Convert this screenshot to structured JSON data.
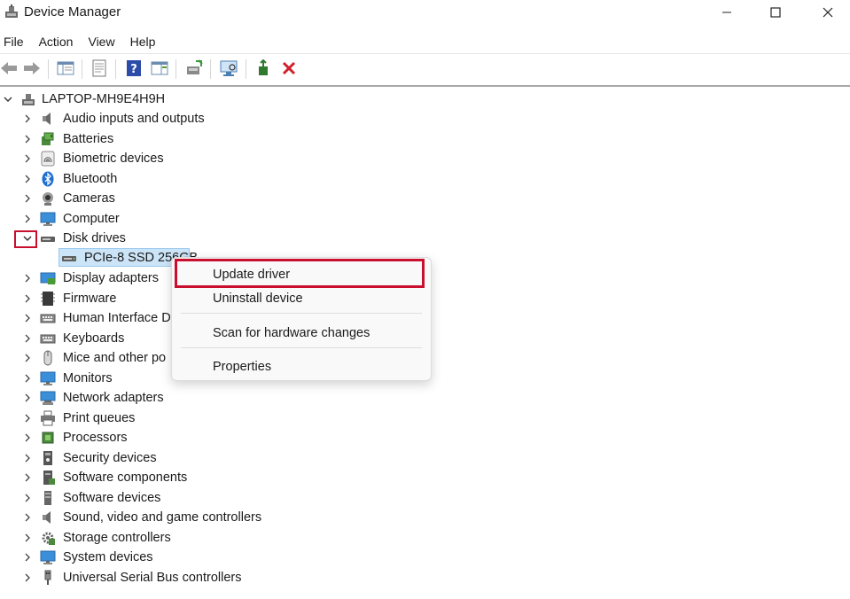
{
  "window": {
    "title": "Device Manager"
  },
  "menu": [
    "File",
    "Action",
    "View",
    "Help"
  ],
  "tree": {
    "root": "LAPTOP-MH9E4H9H",
    "categories": [
      {
        "label": "Audio inputs and outputs",
        "icon": "speaker-icon"
      },
      {
        "label": "Batteries",
        "icon": "battery-icon"
      },
      {
        "label": "Biometric devices",
        "icon": "fingerprint-icon"
      },
      {
        "label": "Bluetooth",
        "icon": "bluetooth-icon"
      },
      {
        "label": "Cameras",
        "icon": "camera-icon"
      },
      {
        "label": "Computer",
        "icon": "monitor-icon"
      },
      {
        "label": "Disk drives",
        "icon": "disk-drive-icon",
        "expanded": true
      },
      {
        "label": "Display adapters",
        "icon": "display-adapter-icon"
      },
      {
        "label": "Firmware",
        "icon": "firmware-icon"
      },
      {
        "label": "Human Interface D",
        "icon": "keyboard-icon"
      },
      {
        "label": "Keyboards",
        "icon": "keyboard-icon"
      },
      {
        "label": "Mice and other po",
        "icon": "mouse-icon"
      },
      {
        "label": "Monitors",
        "icon": "monitor-icon"
      },
      {
        "label": "Network adapters",
        "icon": "network-icon"
      },
      {
        "label": "Print queues",
        "icon": "printer-icon"
      },
      {
        "label": "Processors",
        "icon": "processor-icon"
      },
      {
        "label": "Security devices",
        "icon": "security-icon"
      },
      {
        "label": "Software components",
        "icon": "software-component-icon"
      },
      {
        "label": "Software devices",
        "icon": "software-device-icon"
      },
      {
        "label": "Sound, video and game controllers",
        "icon": "speaker-icon"
      },
      {
        "label": "Storage controllers",
        "icon": "storage-controller-icon"
      },
      {
        "label": "System devices",
        "icon": "system-device-icon"
      },
      {
        "label": "Universal Serial Bus controllers",
        "icon": "usb-icon"
      }
    ],
    "disk_child": "PCIe-8 SSD 256GB"
  },
  "context_menu": {
    "items": [
      "Update driver",
      "Uninstall device",
      "Scan for hardware changes",
      "Properties"
    ],
    "highlighted": "Update driver"
  },
  "colors": {
    "highlight_border": "#c8102e",
    "selection_bg": "#cce4f7",
    "window_bg": "#ffffff"
  }
}
